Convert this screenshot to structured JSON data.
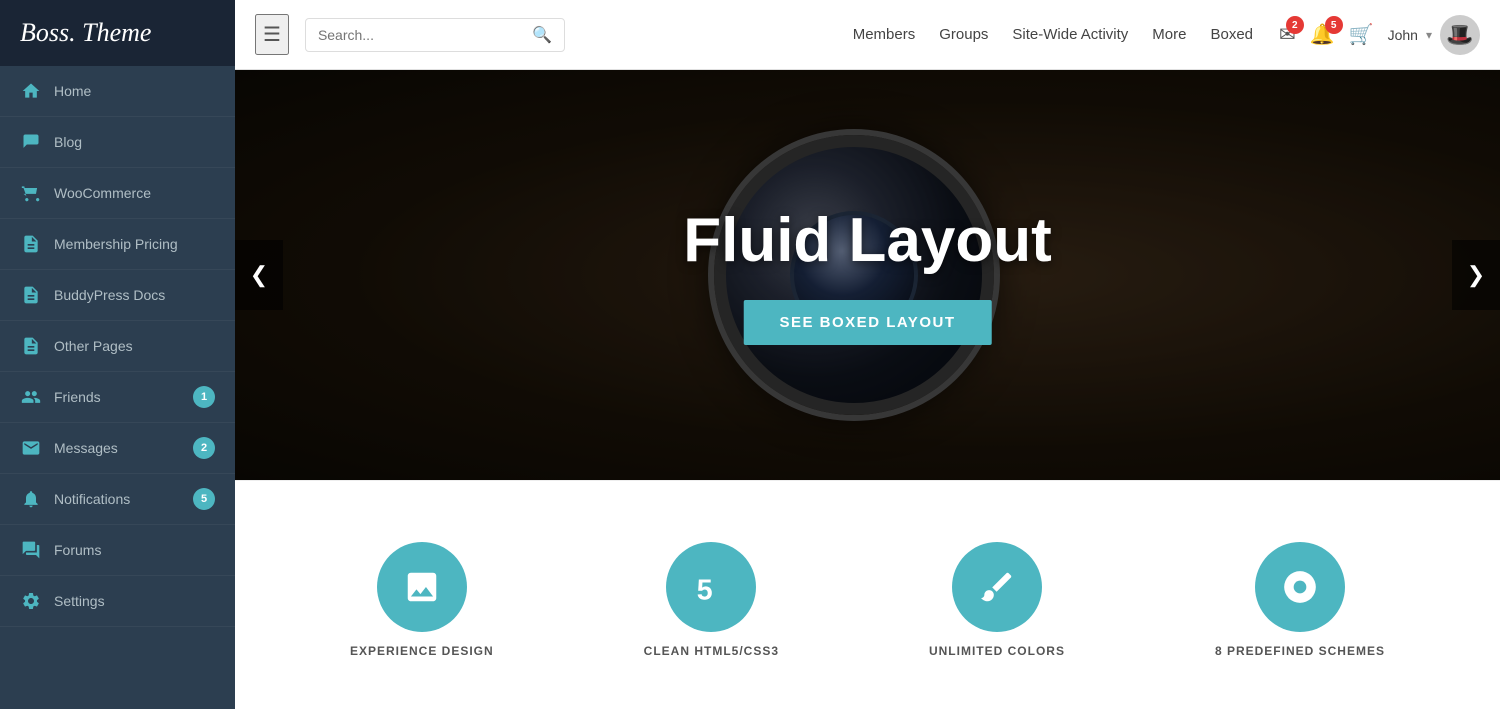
{
  "logo": {
    "text": "Boss. Theme"
  },
  "sidebar": {
    "items": [
      {
        "id": "home",
        "label": "Home",
        "icon": "🏠",
        "badge": null
      },
      {
        "id": "blog",
        "label": "Blog",
        "icon": "📝",
        "badge": null
      },
      {
        "id": "woocommerce",
        "label": "WooCommerce",
        "icon": "🛒",
        "badge": null
      },
      {
        "id": "membership-pricing",
        "label": "Membership Pricing",
        "icon": "📄",
        "badge": null
      },
      {
        "id": "buddypress-docs",
        "label": "BuddyPress Docs",
        "icon": "📄",
        "badge": null
      },
      {
        "id": "other-pages",
        "label": "Other Pages",
        "icon": "📄",
        "badge": null
      },
      {
        "id": "friends",
        "label": "Friends",
        "icon": "👥",
        "badge": 1
      },
      {
        "id": "messages",
        "label": "Messages",
        "icon": "✉️",
        "badge": 2
      },
      {
        "id": "notifications",
        "label": "Notifications",
        "icon": "🔔",
        "badge": 5
      },
      {
        "id": "forums",
        "label": "Forums",
        "icon": "💬",
        "badge": null
      },
      {
        "id": "settings",
        "label": "Settings",
        "icon": "⚙️",
        "badge": null
      }
    ]
  },
  "header": {
    "search_placeholder": "Search...",
    "nav_items": [
      {
        "id": "members",
        "label": "Members"
      },
      {
        "id": "groups",
        "label": "Groups"
      },
      {
        "id": "site-wide-activity",
        "label": "Site-Wide Activity"
      },
      {
        "id": "more",
        "label": "More"
      },
      {
        "id": "boxed",
        "label": "Boxed"
      }
    ],
    "messages_badge": 2,
    "notifications_badge": 5,
    "user": {
      "name": "John",
      "avatar": "🎩"
    }
  },
  "hero": {
    "title": "Fluid Layout",
    "cta_label": "SEE BOXED LAYOUT",
    "prev_label": "❮",
    "next_label": "❯"
  },
  "features": [
    {
      "id": "experience-design",
      "icon": "🖼",
      "label": "EXPERIENCE DESIGN"
    },
    {
      "id": "clean-html-css",
      "icon": "5",
      "label": "CLEAN HTML5/CSS3"
    },
    {
      "id": "unlimited-colors",
      "icon": "✏️",
      "label": "UNLIMITED COLORS"
    },
    {
      "id": "predefined-schemes",
      "icon": "💣",
      "label": "8 PREDEFINED SCHEMES"
    }
  ]
}
